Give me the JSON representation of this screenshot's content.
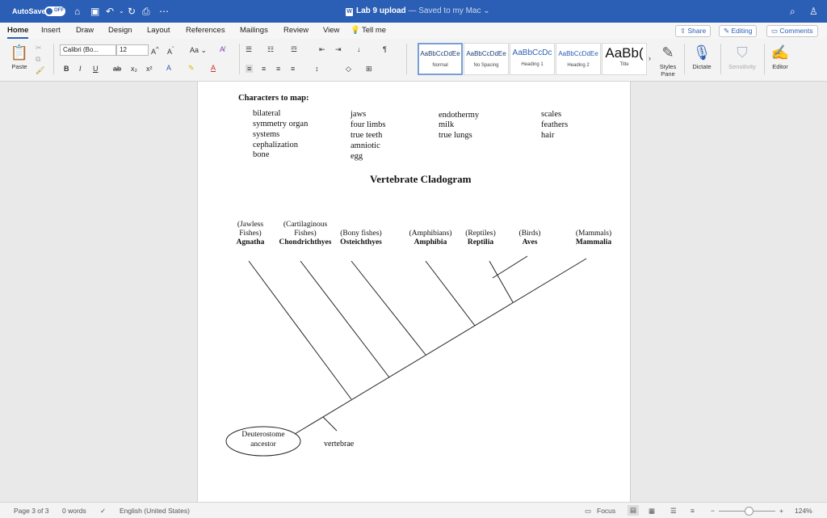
{
  "titlebar": {
    "autosave_label": "AutoSave",
    "autosave_state": "OFF",
    "doc_name": "Lab 9 upload",
    "save_status": "— Saved to my Mac"
  },
  "tabs": [
    "Home",
    "Insert",
    "Draw",
    "Design",
    "Layout",
    "References",
    "Mailings",
    "Review",
    "View",
    "Tell me"
  ],
  "tab_buttons": {
    "share": "Share",
    "editing": "Editing",
    "comments": "Comments"
  },
  "ribbon": {
    "paste": "Paste",
    "font": "Calibri (Bo...",
    "size": "12",
    "aa": "Aa",
    "styles": [
      {
        "sample": "AaBbCcDdEe",
        "name": "Normal"
      },
      {
        "sample": "AaBbCcDdEe",
        "name": "No Spacing"
      },
      {
        "sample": "AaBbCcDc",
        "name": "Heading 1"
      },
      {
        "sample": "AaBbCcDdEe",
        "name": "Heading 2"
      },
      {
        "sample": "AaBb(",
        "name": "Title"
      }
    ],
    "styles_pane": "Styles Pane",
    "dictate": "Dictate",
    "sensitivity": "Sensitivity",
    "editor": "Editor"
  },
  "document": {
    "characters_heading": "Characters to map:",
    "char_col1": [
      "bilateral",
      "symmetry organ",
      "systems",
      "cephalization",
      "bone"
    ],
    "char_col2": [
      "jaws",
      "four limbs",
      "true teeth",
      "amniotic",
      "egg"
    ],
    "char_col3": [
      "endothermy",
      "milk",
      "true lungs"
    ],
    "char_col4": [
      "scales",
      "feathers",
      "hair"
    ],
    "cladogram_title": "Vertebrate Cladogram",
    "taxa": [
      {
        "common1": "(Jawless",
        "common2": "Fishes)",
        "latin": "Agnatha"
      },
      {
        "common1": "(Cartilaginous",
        "common2": "Fishes)",
        "latin": "Chondrichthyes"
      },
      {
        "common1": "",
        "common2": "(Bony fishes)",
        "latin": "Osteichthyes"
      },
      {
        "common1": "",
        "common2": "(Amphibians)",
        "latin": "Amphibia"
      },
      {
        "common1": "",
        "common2": "(Reptiles)",
        "latin": "Reptilia"
      },
      {
        "common1": "",
        "common2": "(Birds)",
        "latin": "Aves"
      },
      {
        "common1": "",
        "common2": "(Mammals)",
        "latin": "Mammalia"
      }
    ],
    "ancestor_line1": "Deuterostome",
    "ancestor_line2": "ancestor",
    "trait_label": "vertebrae"
  },
  "status": {
    "page": "Page 3 of 3",
    "words": "0 words",
    "language": "English (United States)",
    "focus": "Focus",
    "zoom": "124%"
  }
}
